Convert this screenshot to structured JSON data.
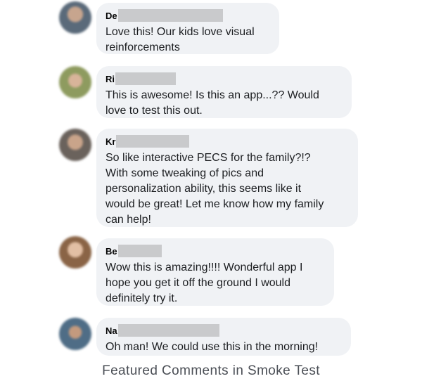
{
  "comments": [
    {
      "name": "De",
      "text": "Love this! Our kids love visual\nreinforcements",
      "avatar_color": "#6b7b8a"
    },
    {
      "name": "Ri",
      "text": "This is awesome!  Is this an app...?? Would\nlove to test this out.",
      "avatar_color": "#9aa36e"
    },
    {
      "name": "Kr",
      "text": "So like interactive PECS for the family?!?\nWith some tweaking of pics and\npersonalization ability, this seems like it\nwould be great! Let me know how my family\ncan help!",
      "avatar_color": "#7a6e66"
    },
    {
      "name": "Be",
      "text": "Wow this is amazing!!!! Wonderful app I\nhope you get it off the ground I would\ndefinitely try it.",
      "avatar_color": "#a07a5c"
    },
    {
      "name": "Na",
      "text": "Oh man! We could use this in the morning!",
      "avatar_color": "#5f7a8f"
    }
  ],
  "caption": "Featured Comments in Smoke Test",
  "colors": {
    "bubble": "#f0f2f5",
    "redaction": "#c9cacc",
    "caption": "#4b4f56"
  }
}
